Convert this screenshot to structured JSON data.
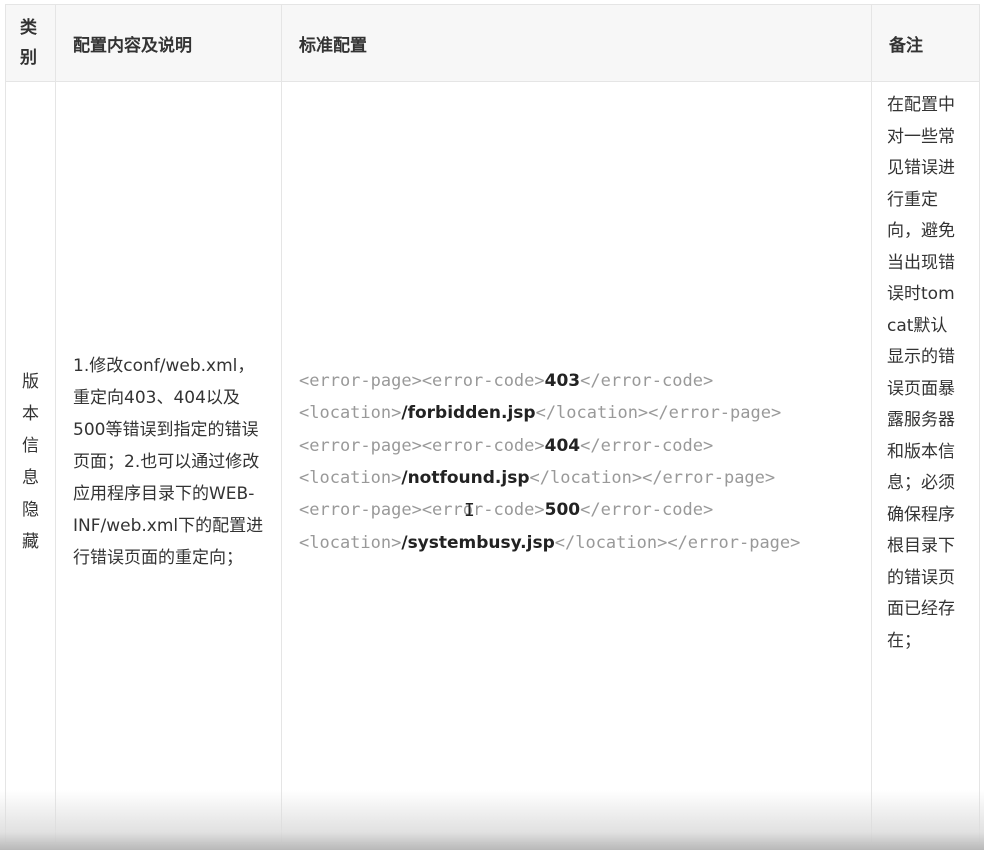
{
  "table": {
    "headers": {
      "category": "类别",
      "description": "配置内容及说明",
      "standard": "标准配置",
      "note": "备注"
    },
    "row": {
      "category": "版本信息隐藏",
      "description": "1.修改conf/web.xml，重定向403、404以及500等错误到指定的错误页面；2.也可以通过修改应用程序目录下的WEB-INF/web.xml下的配置进行错误页面的重定向；",
      "code_lines": [
        {
          "pre": "<error-page><error-code>",
          "value": "403",
          "post": "</error-code>"
        },
        {
          "pre": "<location>",
          "value": "/forbidden.jsp",
          "post": "</location></error-page>"
        },
        {
          "pre": "<error-page><error-code>",
          "value": "404",
          "post": "</error-code>"
        },
        {
          "pre": "<location>",
          "value": "/notfound.jsp",
          "post": "</location></error-page>"
        },
        {
          "pre": "<error-page><error-code>",
          "value": "500",
          "post": "</error-code>"
        },
        {
          "pre": "<location>",
          "value": "/systembusy.jsp",
          "post": "</location></error-page>"
        }
      ],
      "note": "在配置中对一些常见错误进行重定向，避免当出现错误时tomcat默认显示的错误页面暴露服务器和版本信息；必须确保程序根目录下的错误页面已经存在；"
    }
  },
  "cursor_glyph": "I"
}
